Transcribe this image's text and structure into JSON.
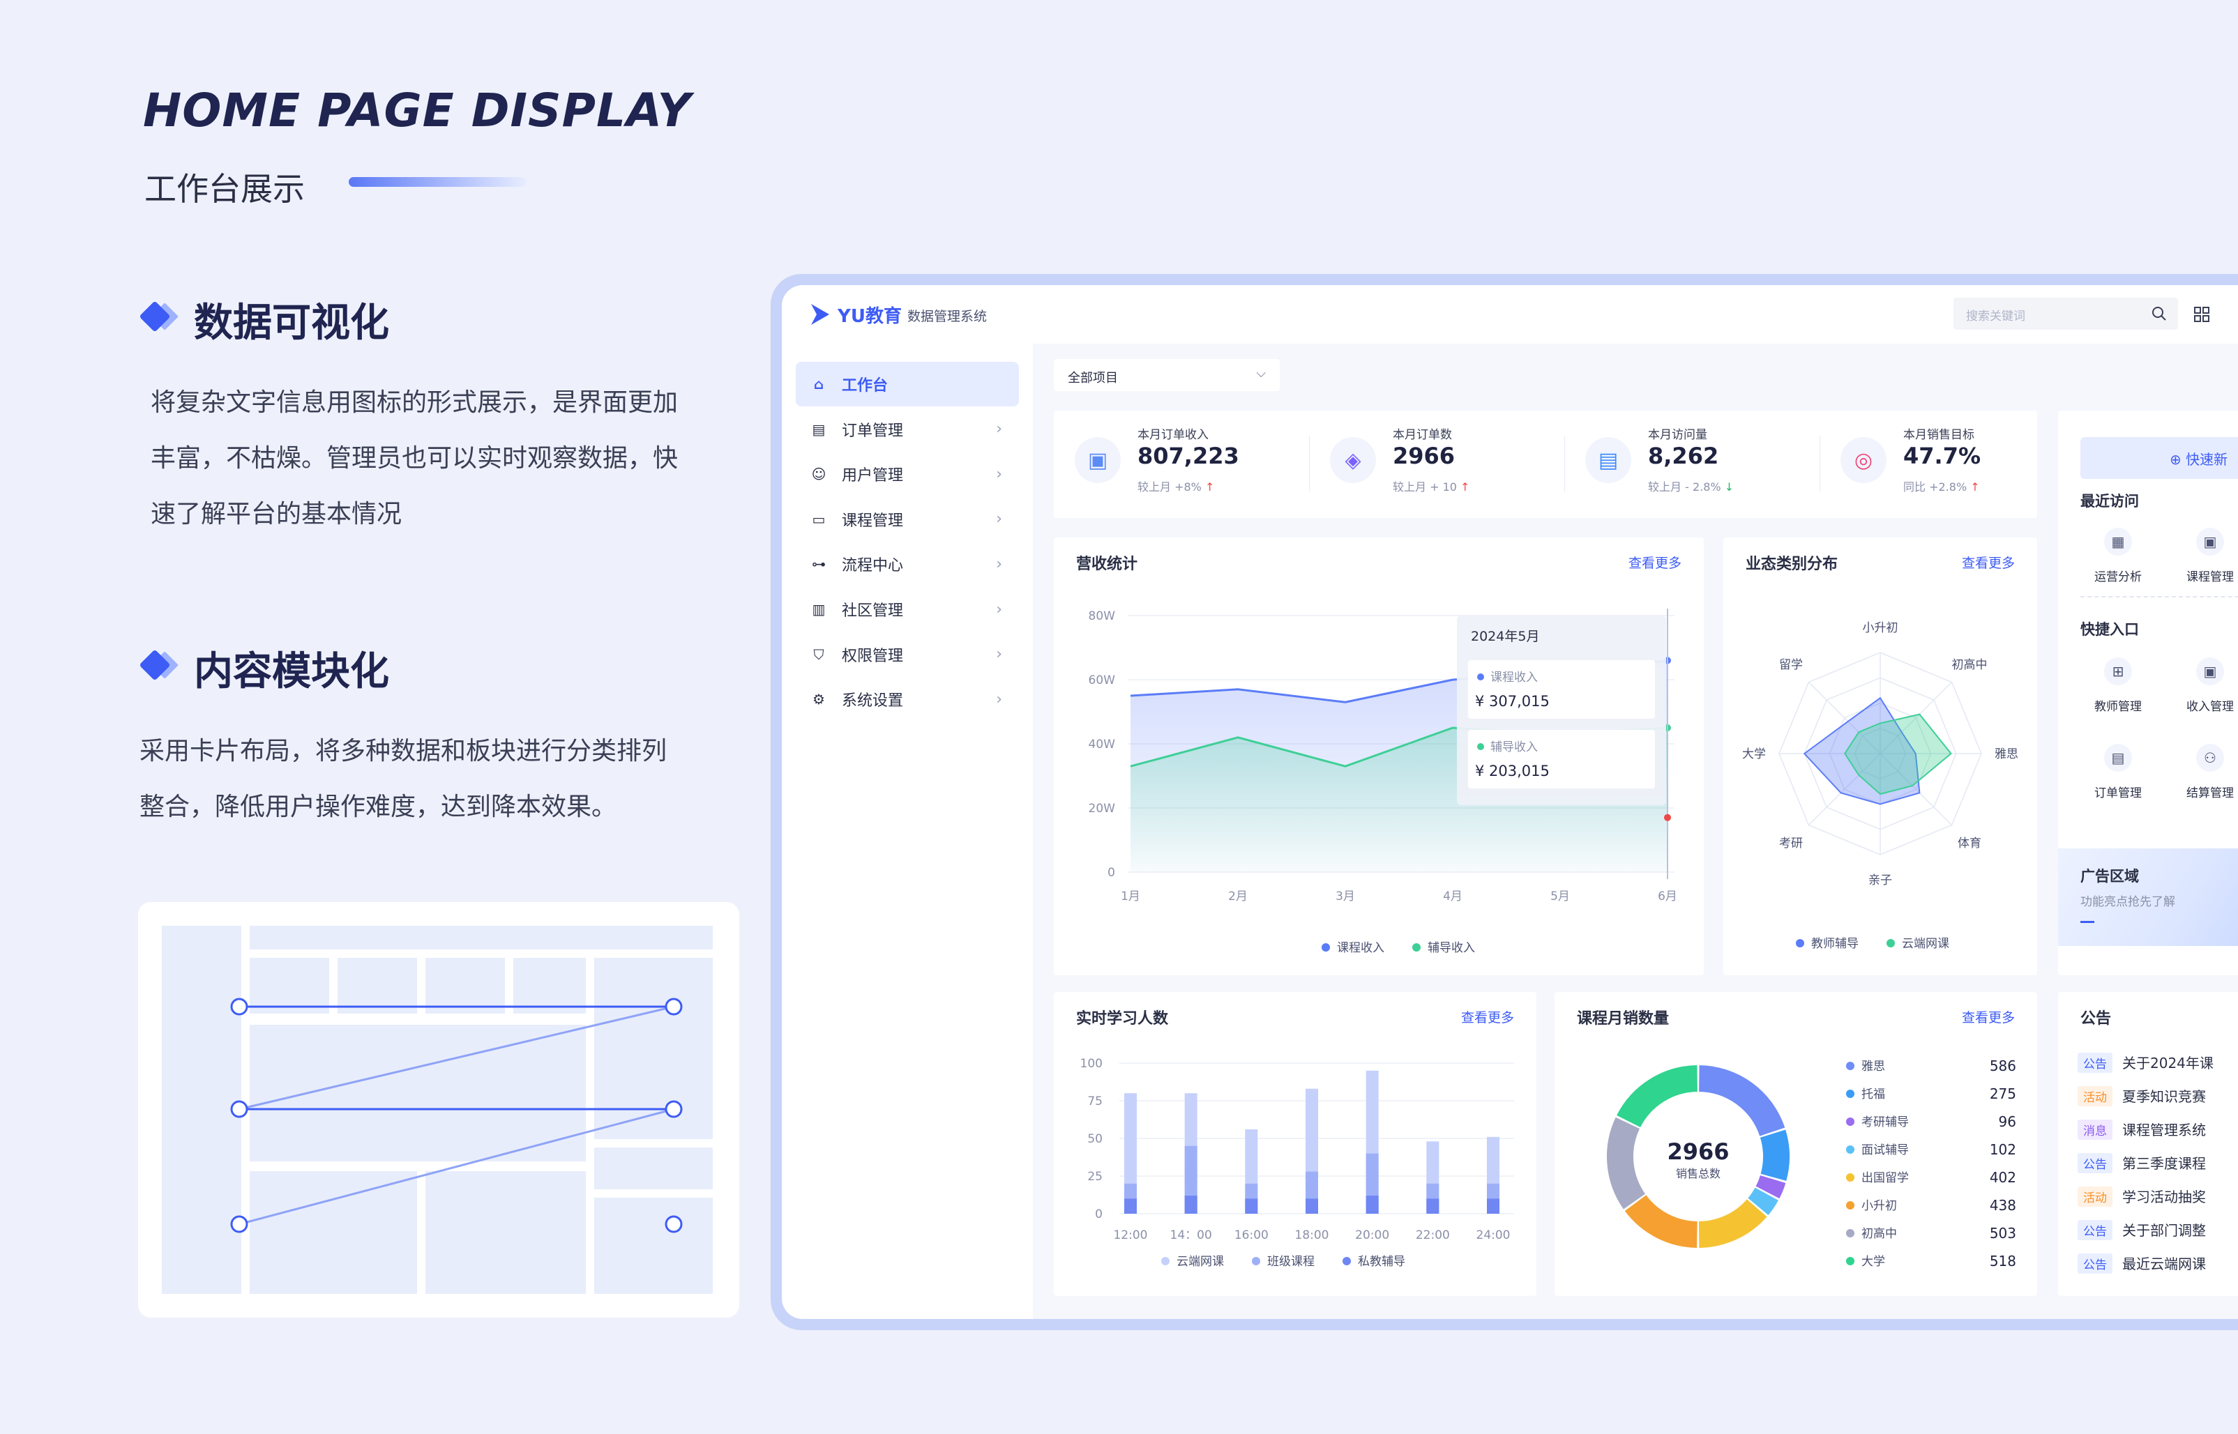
{
  "intro": {
    "title_en": "HOME PAGE DISPLAY",
    "title_cn": "工作台展示",
    "sections": [
      {
        "title": "数据可视化",
        "lines": [
          "将复杂文字信息用图标的形式展示，是界面更加",
          "丰富，不枯燥。管理员也可以实时观察数据，快",
          "速了解平台的基本情况"
        ]
      },
      {
        "title": "内容模块化",
        "lines": [
          "采用卡片布局，将多种数据和板块进行分类排列",
          "整合，降低用户操作难度，达到降本效果。"
        ]
      }
    ]
  },
  "app": {
    "logo": "YU教育",
    "subtitle": "数据管理系统",
    "search_placeholder": "搜索关键词",
    "filter": "全部项目",
    "nav": [
      {
        "label": "工作台",
        "icon": "home-icon",
        "active": true
      },
      {
        "label": "订单管理",
        "icon": "clipboard-icon"
      },
      {
        "label": "用户管理",
        "icon": "user-icon"
      },
      {
        "label": "课程管理",
        "icon": "folder-icon"
      },
      {
        "label": "流程中心",
        "icon": "flow-icon"
      },
      {
        "label": "社区管理",
        "icon": "building-icon"
      },
      {
        "label": "权限管理",
        "icon": "shield-icon"
      },
      {
        "label": "系统设置",
        "icon": "gear-icon"
      }
    ],
    "stats": [
      {
        "label": "本月订单收入",
        "value": "807,223",
        "cmp": "较上月",
        "change": "+8%",
        "dir": "up",
        "icon": "wallet-icon",
        "color": "#5b8cf5"
      },
      {
        "label": "本月订单数",
        "value": "2966",
        "cmp": "较上月",
        "change": "+ 10",
        "dir": "up",
        "icon": "bag-icon",
        "color": "#7b61ff"
      },
      {
        "label": "本月访问量",
        "value": "8,262",
        "cmp": "较上月",
        "change": "- 2.8%",
        "dir": "down",
        "icon": "document-icon",
        "color": "#3d8bfd"
      },
      {
        "label": "本月销售目标",
        "value": "47.7%",
        "cmp": "同比",
        "change": "+2.8%",
        "dir": "up",
        "icon": "target-icon",
        "color": "#f0487a"
      }
    ],
    "more": "查看更多",
    "quick": {
      "new_btn": "⊕ 快速新",
      "recent_title": "最近访问",
      "recent": [
        {
          "label": "运营分析",
          "icon": "chart-icon"
        },
        {
          "label": "课程管理",
          "icon": "briefcase-icon"
        }
      ],
      "entry_title": "快捷入口",
      "entries": [
        {
          "label": "教师管理",
          "icon": "grid-icon"
        },
        {
          "label": "收入管理",
          "icon": "wallet-icon"
        },
        {
          "label": "订单管理",
          "icon": "clipboard-icon"
        },
        {
          "label": "结算管理",
          "icon": "users-icon"
        }
      ],
      "ad_title": "广告区域",
      "ad_sub": "功能亮点抢先了解"
    },
    "notices": {
      "title": "公告",
      "items": [
        {
          "tag": "公告",
          "text": "关于2024年课",
          "type": "notice"
        },
        {
          "tag": "活动",
          "text": "夏季知识竞赛",
          "type": "event"
        },
        {
          "tag": "消息",
          "text": "课程管理系统",
          "type": "message"
        },
        {
          "tag": "公告",
          "text": "第三季度课程",
          "type": "notice"
        },
        {
          "tag": "活动",
          "text": "学习活动抽奖",
          "type": "event"
        },
        {
          "tag": "公告",
          "text": "关于部门调整",
          "type": "notice"
        },
        {
          "tag": "公告",
          "text": "最近云端网课",
          "type": "notice"
        }
      ]
    }
  },
  "chart_data": [
    {
      "type": "area",
      "title": "营收统计",
      "categories": [
        "1月",
        "2月",
        "3月",
        "4月",
        "5月",
        "6月"
      ],
      "y_ticks": [
        "0",
        "20W",
        "40W",
        "60W",
        "80W"
      ],
      "ylim": [
        0,
        80
      ],
      "series": [
        {
          "name": "课程收入",
          "values": [
            55,
            57,
            53,
            60,
            62,
            66
          ],
          "color": "#5b7cf7"
        },
        {
          "name": "辅导收入",
          "values": [
            33,
            42,
            33,
            45,
            43,
            45
          ],
          "color": "#3ecf96"
        }
      ],
      "tooltip": {
        "title": "2024年5月",
        "items": [
          {
            "name": "课程收入",
            "value": "¥ 307,015"
          },
          {
            "name": "辅导收入",
            "value": "¥ 203,015"
          }
        ]
      },
      "legend": "bottom"
    },
    {
      "type": "radar",
      "title": "业态类别分布",
      "axes": [
        "小升初",
        "初高中",
        "雅思",
        "体育",
        "亲子",
        "考研",
        "大学",
        "留学"
      ],
      "rmax": 100,
      "series": [
        {
          "name": "教师辅导",
          "values": [
            55,
            30,
            35,
            55,
            50,
            55,
            75,
            45
          ],
          "color": "#5b7cf7"
        },
        {
          "name": "云端网课",
          "values": [
            30,
            55,
            70,
            45,
            40,
            30,
            35,
            30
          ],
          "color": "#3ecf96"
        }
      ],
      "legend": "bottom"
    },
    {
      "type": "bar",
      "title": "实时学习人数",
      "categories": [
        "12:00",
        "14：00",
        "16:00",
        "18:00",
        "20:00",
        "22:00",
        "24:00"
      ],
      "y_ticks": [
        "0",
        "25",
        "50",
        "75",
        "100"
      ],
      "ylim": [
        0,
        100
      ],
      "groups": [
        [
          80,
          55
        ],
        [
          80,
          52
        ],
        [
          56,
          34
        ],
        [
          83,
          48
        ],
        [
          95,
          68
        ],
        [
          48,
          20
        ],
        [
          51,
          35
        ]
      ],
      "stack_levels": [
        [
          20,
          10
        ],
        [
          45,
          12
        ],
        [
          20,
          10
        ],
        [
          28,
          10
        ],
        [
          40,
          12
        ],
        [
          20,
          10
        ],
        [
          20,
          10
        ]
      ],
      "series": [
        {
          "name": "云端网课",
          "color": "#c5d1fb"
        },
        {
          "name": "班级课程",
          "color": "#9db0f7"
        },
        {
          "name": "私教辅导",
          "color": "#6f86f3"
        }
      ],
      "legend": "bottom"
    },
    {
      "type": "pie",
      "title": "课程月销数量",
      "center_value": "2966",
      "center_label": "销售总数",
      "slices": [
        {
          "name": "雅思",
          "value": 586,
          "color": "#6f8cf7"
        },
        {
          "name": "托福",
          "value": 275,
          "color": "#3b9cf5"
        },
        {
          "name": "考研辅导",
          "value": 96,
          "color": "#9a6cf0"
        },
        {
          "name": "面试辅导",
          "value": 102,
          "color": "#5bc0f8"
        },
        {
          "name": "出国留学",
          "value": 402,
          "color": "#f5c232"
        },
        {
          "name": "小升初",
          "value": 438,
          "color": "#f5a030"
        },
        {
          "name": "初高中",
          "value": 503,
          "color": "#a7aac4"
        },
        {
          "name": "大学",
          "value": 518,
          "color": "#2fd48e"
        }
      ]
    }
  ]
}
